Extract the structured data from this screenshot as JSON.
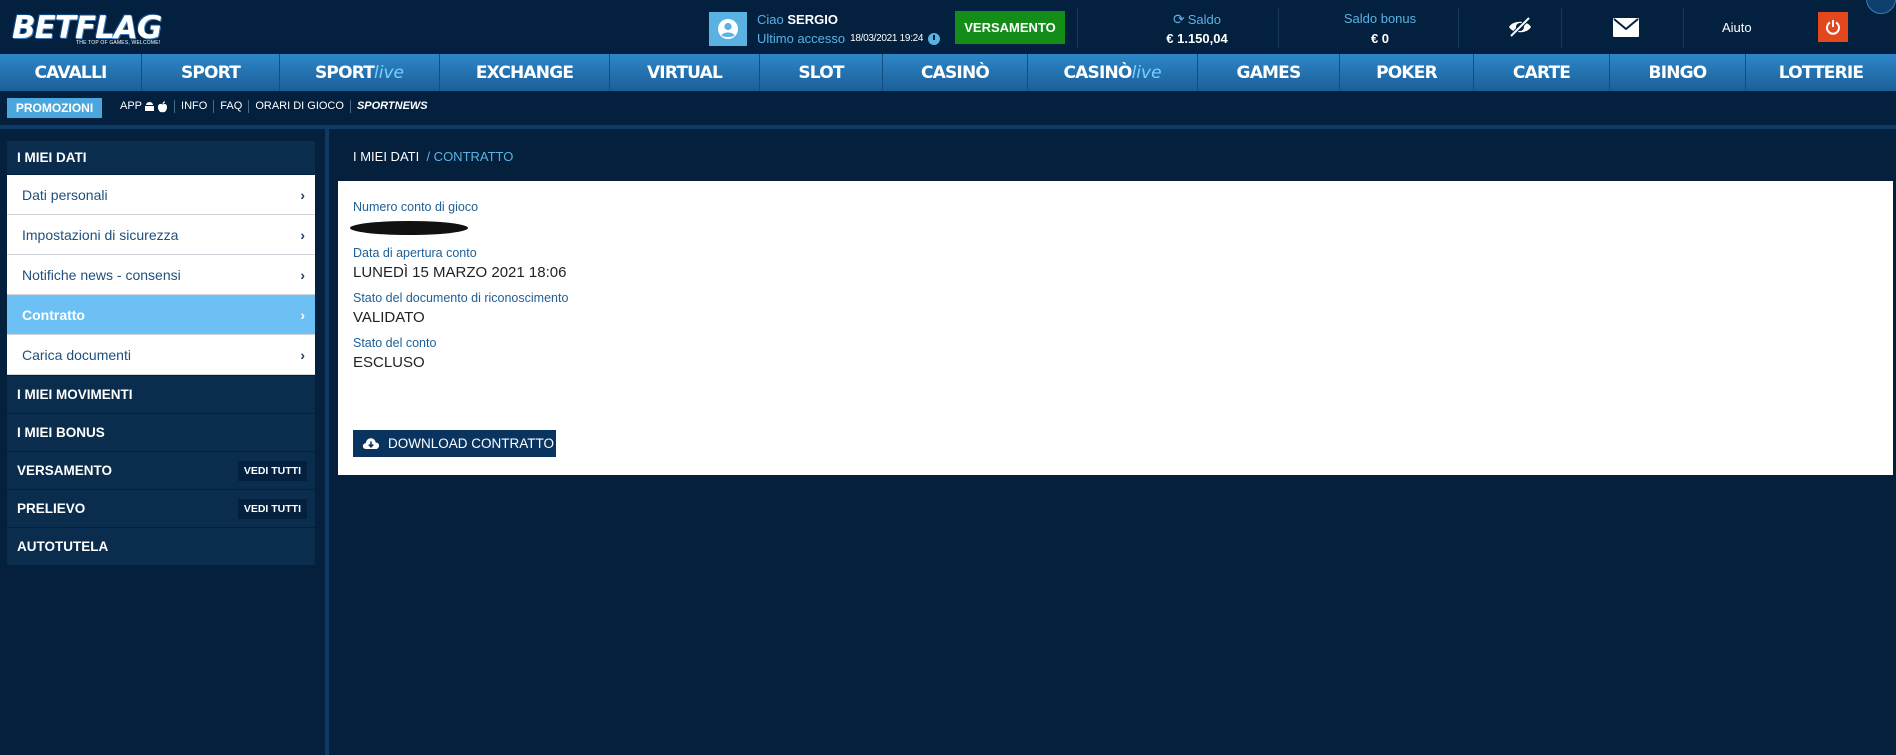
{
  "brand": {
    "logo": "BETFLAG",
    "tagline": "THE TOP OF GAMES, WELCOME!"
  },
  "header": {
    "greeting_prefix": "Ciao",
    "username": "SERGIO",
    "last_access_label": "Ultimo accesso",
    "last_access_value": "18/03/2021 19:24",
    "deposit_button": "VERSAMENTO",
    "balance_label": "Saldo",
    "balance_value": "€ 1.150,04",
    "bonus_label": "Saldo bonus",
    "bonus_value": "€ 0",
    "help": "Aiuto"
  },
  "mainnav": [
    {
      "label": "CAVALLI",
      "suffix": ""
    },
    {
      "label": "SPORT",
      "suffix": ""
    },
    {
      "label": "SPORT",
      "suffix": "live"
    },
    {
      "label": "EXCHANGE",
      "suffix": ""
    },
    {
      "label": "VIRTUAL",
      "suffix": ""
    },
    {
      "label": "SLOT",
      "suffix": ""
    },
    {
      "label": "CASINÒ",
      "suffix": ""
    },
    {
      "label": "CASINÒ",
      "suffix": "live"
    },
    {
      "label": "GAMES",
      "suffix": ""
    },
    {
      "label": "POKER",
      "suffix": ""
    },
    {
      "label": "CARTE",
      "suffix": ""
    },
    {
      "label": "BINGO",
      "suffix": ""
    },
    {
      "label": "LOTTERIE",
      "suffix": ""
    }
  ],
  "subnav": {
    "promo": "PROMOZIONI",
    "app": "APP",
    "info": "INFO",
    "faq": "FAQ",
    "orari": "ORARI DI GIOCO",
    "sportnews": "SPORTNEWS"
  },
  "sidebar": {
    "section_title": "I MIEI DATI",
    "items": [
      {
        "label": "Dati personali"
      },
      {
        "label": "Impostazioni di sicurezza"
      },
      {
        "label": "Notifiche news - consensi"
      },
      {
        "label": "Contratto"
      },
      {
        "label": "Carica documenti"
      }
    ],
    "sections": [
      {
        "label": "I MIEI MOVIMENTI",
        "action": ""
      },
      {
        "label": "I MIEI BONUS",
        "action": ""
      },
      {
        "label": "VERSAMENTO",
        "action": "VEDI TUTTI"
      },
      {
        "label": "PRELIEVO",
        "action": "VEDI TUTTI"
      },
      {
        "label": "AUTOTUTELA",
        "action": ""
      }
    ]
  },
  "content": {
    "breadcrumb_root": "I MIEI DATI",
    "breadcrumb_current": "/ CONTRATTO",
    "account_number_label": "Numero conto di gioco",
    "opening_date_label": "Data di apertura conto",
    "opening_date_value": "LUNEDÌ 15 MARZO 2021 18:06",
    "id_status_label": "Stato del documento di riconoscimento",
    "id_status_value": "VALIDATO",
    "account_status_label": "Stato del conto",
    "account_status_value": "ESCLUSO",
    "download_button": "DOWNLOAD CONTRATTO"
  },
  "colors": {
    "background": "#04203d",
    "nav_blue": "#2e86c8",
    "accent_light": "#5ab2e3",
    "active_item": "#6cc0f4",
    "deposit_green": "#138d18",
    "power_orange": "#e2471d"
  }
}
